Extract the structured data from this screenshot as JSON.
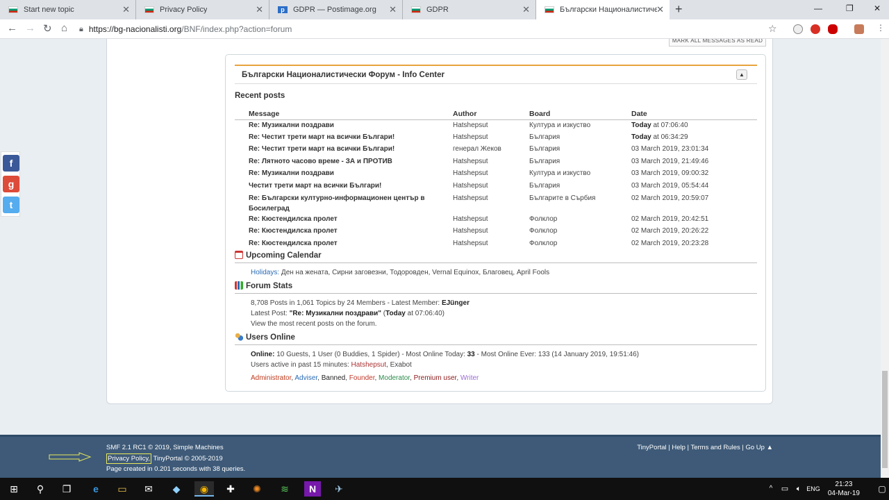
{
  "browser": {
    "tabs": [
      {
        "title": "Start new topic",
        "icon": "bg-flag-icon"
      },
      {
        "title": "Privacy Policy",
        "icon": "bg-flag-icon"
      },
      {
        "title": "GDPR — Postimage.org",
        "icon": "postimage-icon"
      },
      {
        "title": "GDPR",
        "icon": "bg-flag-icon"
      },
      {
        "title": "Български Националистически",
        "icon": "bg-flag-icon",
        "active": true
      }
    ],
    "new_tab": "+",
    "url_host": "https://bg-nacionalisti.org",
    "url_path": "/BNF/index.php?action=forum"
  },
  "forum": {
    "mark_read": "MARK ALL MESSAGES AS READ",
    "info_center_title": "Български Националистически Форум - Info Center",
    "recent_posts": {
      "heading": "Recent posts",
      "columns": [
        "Message",
        "Author",
        "Board",
        "Date"
      ],
      "rows": [
        {
          "message": "Re: Музикални поздрави",
          "author": "Hatshepsut",
          "board": "Култура и изкуство",
          "date_bold": "Today",
          "date": " at 07:06:40"
        },
        {
          "message": "Re: Честит трети март на всички Българи!",
          "author": "Hatshepsut",
          "board": "България",
          "date_bold": "Today",
          "date": " at 06:34:29"
        },
        {
          "message": "Re: Честит трети март на всички Българи!",
          "author": "генерал Жеков",
          "board": "България",
          "date_bold": "",
          "date": "03 March 2019, 23:01:34"
        },
        {
          "message": "Re: Лятното часово време - ЗА и ПРОТИВ",
          "author": "Hatshepsut",
          "board": "България",
          "date_bold": "",
          "date": "03 March 2019, 21:49:46"
        },
        {
          "message": "Re: Музикални поздрави",
          "author": "Hatshepsut",
          "board": "Култура и изкуство",
          "date_bold": "",
          "date": "03 March 2019, 09:00:32"
        },
        {
          "message": "Честит трети март на всички Българи!",
          "author": "Hatshepsut",
          "board": "България",
          "date_bold": "",
          "date": "03 March 2019, 05:54:44"
        },
        {
          "message": "Re: Български културно-информационен център в Босилеград",
          "author": "Hatshepsut",
          "board": "Българите в Сърбия",
          "date_bold": "",
          "date": "02 March 2019, 20:59:07"
        },
        {
          "message": "Re: Кюстендилска пролет",
          "author": "Hatshepsut",
          "board": "Фолклор",
          "date_bold": "",
          "date": "02 March 2019, 20:42:51"
        },
        {
          "message": "Re: Кюстендилска пролет",
          "author": "Hatshepsut",
          "board": "Фолклор",
          "date_bold": "",
          "date": "02 March 2019, 20:26:22"
        },
        {
          "message": "Re: Кюстендилска пролет",
          "author": "Hatshepsut",
          "board": "Фолклор",
          "date_bold": "",
          "date": "02 March 2019, 20:23:28"
        }
      ]
    },
    "calendar": {
      "heading": "Upcoming Calendar",
      "holidays_label": "Holidays:",
      "holidays": " Ден на жената, Сирни заговезни, Тодоровден, Vernal Equinox, Благовец, April Fools"
    },
    "stats": {
      "heading": "Forum Stats",
      "line1": "8,708 Posts in 1,061 Topics by 24 Members - Latest Member: ",
      "latest_member": "EJünger",
      "line2_prefix": "Latest Post: ",
      "latest_post": "\"Re: Музикални поздрави\"",
      "line2_open": " (",
      "line2_today": "Today",
      "line2_suffix": " at 07:06:40)",
      "line3": "View the most recent posts on the forum."
    },
    "online": {
      "heading": "Users Online",
      "online_label": "Online:",
      "online_text": " 10 Guests, 1 User (0 Buddies, 1 Spider)  - Most Online Today: ",
      "most_today": "33",
      "online_tail": " -  Most Online Ever: 133 (14 January 2019, 19:51:46)",
      "active_label": "Users active in past 15 minutes: ",
      "active_users": "Hatshepsut",
      "active_users_2": ", Exabot",
      "groups": [
        {
          "name": "Administrator",
          "color": "#bf3b1f",
          "sep": ", "
        },
        {
          "name": "Adviser",
          "color": "#2a6bb5",
          "sep": ", "
        },
        {
          "name": "Banned",
          "color": "#222222",
          "sep": ", "
        },
        {
          "name": "Founder",
          "color": "#c0392b",
          "sep": ", "
        },
        {
          "name": "Moderator",
          "color": "#2c8a4a",
          "sep": ", "
        },
        {
          "name": "Premium user",
          "color": "#8b1a1a",
          "sep": ", "
        },
        {
          "name": "Writer",
          "color": "#9a6bd4",
          "sep": ""
        }
      ]
    }
  },
  "footer": {
    "line1": "SMF 2.1 RC1 © 2019, Simple Machines",
    "privacy": "Privacy Policy,",
    "line2_tail": " TinyPortal © 2005-2019",
    "line3": "Page created in 0.201 seconds with 38 queries.",
    "links": "TinyPortal | Help | Terms and Rules | Go Up ▲"
  },
  "taskbar": {
    "lang": "ENG",
    "time": "21:23",
    "date": "04-Mar-19"
  }
}
